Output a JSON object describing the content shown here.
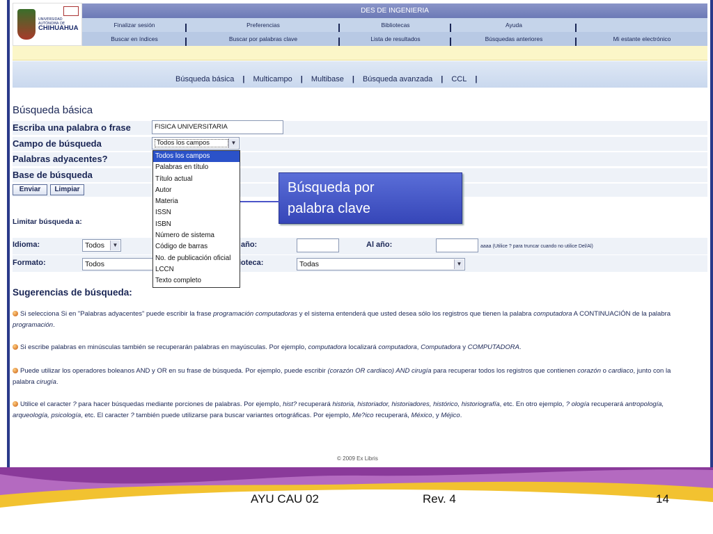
{
  "logo": {
    "name": "CHIHUAHUA",
    "small": "UNIVERSIDAD AUTÓNOMA DE"
  },
  "header": {
    "title": "DES DE INGENIERIA",
    "nav_row1": [
      "Finalizar sesión",
      "Preferencias",
      "Bibliotecas",
      "Ayuda",
      ""
    ],
    "nav_row2": [
      "Buscar en índices",
      "Buscar por palabras clave",
      "Lista de resultados",
      "Búsquedas anteriores",
      "Mi estante electrónico"
    ]
  },
  "sub_nav": [
    "Búsqueda básica",
    "Multicampo",
    "Multibase",
    "Búsqueda avanzada",
    "CCL"
  ],
  "form": {
    "title": "Búsqueda básica",
    "label_word": "Escriba una palabra o frase",
    "word_value": "FISICA UNIVERSITARIA",
    "label_field": "Campo de búsqueda",
    "field_value": "Todos los campos",
    "label_adjacent": "Palabras adyacentes?",
    "label_base": "Base de búsqueda",
    "submit": "Enviar",
    "clear": "Limpiar"
  },
  "dropdown_options": [
    "Todos los campos",
    "Palabras en título",
    "Título actual",
    "Autor",
    "Materia",
    "ISSN",
    "ISBN",
    "Número de sistema",
    "Código de barras",
    "No. de publicación oficial",
    "LCCN",
    "Texto completo"
  ],
  "callout": {
    "line1": "Búsqueda por",
    "line2": "palabra clave"
  },
  "limit": {
    "title": "Limitar búsqueda a:",
    "idioma_label": "Idioma:",
    "idioma_value": "Todos",
    "from_year_label": "año:",
    "to_year_label": "Al año:",
    "year_hint": "aaaa (Utilice ? para truncar cuando no utilice Del/Al)",
    "format_label": "Formato:",
    "format_value": "Todos",
    "library_label": "ioteca:",
    "library_value": "Todas"
  },
  "suggestions": {
    "title": "Sugerencias de búsqueda:",
    "s1a": "Si selecciona Si en \"Palabras adyacentes\" puede escribir la frase ",
    "s1b": "programación computadoras",
    "s1c": " y el sistema entenderá que usted desea sólo los registros que tienen la palabra ",
    "s1d": "computadora",
    "s1e": " A CONTINUACIÓN de la palabra",
    "s1f": "programación",
    "s2a": "Si escribe palabras en minúsculas también se recuperarán palabras en mayúsculas. Por ejemplo, ",
    "s2b": "computadora",
    "s2c": " localizará ",
    "s2d": "computadora",
    "s2e": ", ",
    "s2f": "Computadora",
    "s2g": " y ",
    "s2h": "COMPUTADORA",
    "s3a": "Puede utilizar los operadores boleanos AND y OR en su frase de búsqueda. Por ejemplo, puede escribir ",
    "s3b": "(corazón OR cardiaco) AND cirugía",
    "s3c": " para recuperar todos los registros que contienen ",
    "s3d": "corazón",
    "s3e": " o ",
    "s3f": "cardiaco",
    "s3g": ", junto con la",
    "s3h": "palabra ",
    "s3i": "cirugía",
    "s4a": "Utilice el caracter ",
    "s4b": "?",
    "s4c": " para hacer búsquedas mediante porciones de palabras. Por ejemplo, ",
    "s4d": "hist?",
    "s4e": " recuperará ",
    "s4f": "historia, historiador, historiadores, histórico, historiografía",
    "s4g": ", etc. En otro ejemplo, ",
    "s4h": "? ología",
    "s4i": " recuperará ",
    "s4j": "antropología,",
    "s4k": "arqueología, psicología",
    "s4l": ", etc. El caracter ",
    "s4m": "?",
    "s4n": " también puede utilizarse para buscar variantes ortográficas. Por ejemplo, ",
    "s4o": "Me?ico",
    "s4p": " recuperará, ",
    "s4q": "México",
    "s4r": ", y ",
    "s4s": "Méjico",
    "s4t": "."
  },
  "copyright": "© 2009 Ex Libris",
  "footer": {
    "left": "AYU CAU 02",
    "middle": "Rev. 4",
    "page": "14"
  },
  "colors": {
    "nav_text": "#1a2655",
    "callout": "#3c4cc0",
    "footer_purple": "#7a2a8a",
    "footer_gold": "#f2c230"
  },
  "icons": [
    "dropdown-arrow-icon",
    "bullet-icon",
    "arrow-pointer-icon"
  ]
}
